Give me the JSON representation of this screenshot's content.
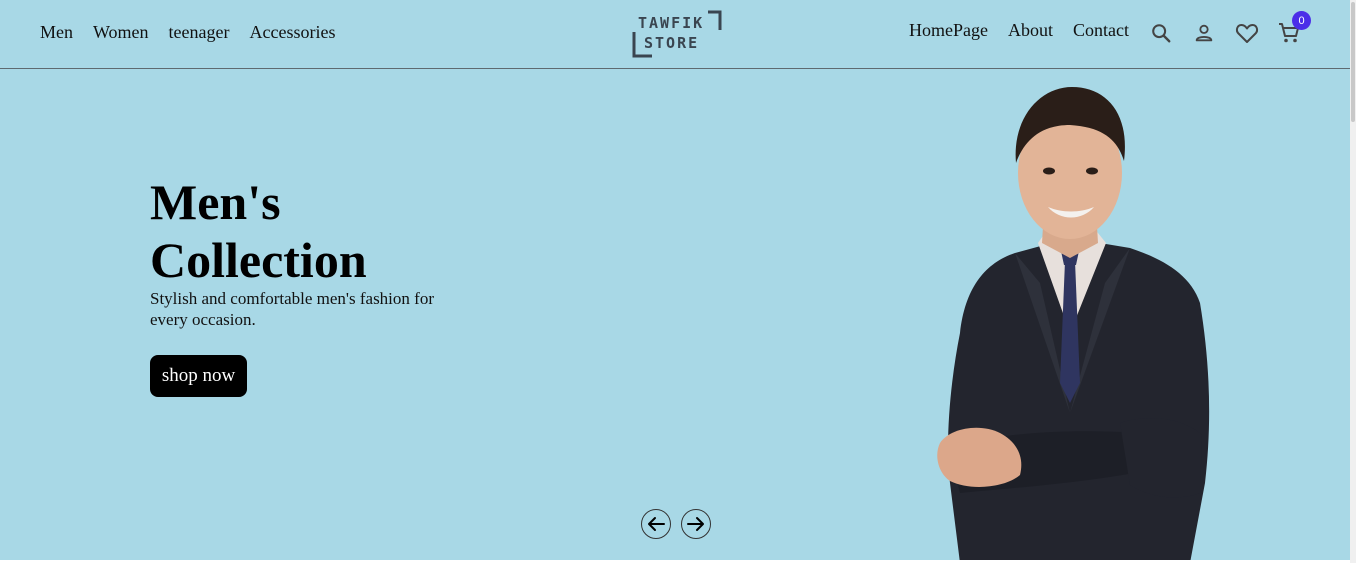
{
  "nav_left": [
    "Men",
    "Women",
    "teenager",
    "Accessories"
  ],
  "logo": {
    "line1": "TAWFIK",
    "line2": "STORE"
  },
  "nav_right": [
    "HomePage",
    "About",
    "Contact"
  ],
  "icons": {
    "search": "search-icon",
    "account": "user-icon",
    "wishlist": "heart-icon",
    "cart": "cart-icon"
  },
  "cart_count": "0",
  "hero": {
    "title_line1": "Men's",
    "title_line2": "Collection",
    "subtitle": "Stylish and comfortable men's fashion for every occasion.",
    "cta": "shop now"
  },
  "colors": {
    "background": "#a8d8e6",
    "badge": "#4b2ee8",
    "button": "#000000"
  }
}
